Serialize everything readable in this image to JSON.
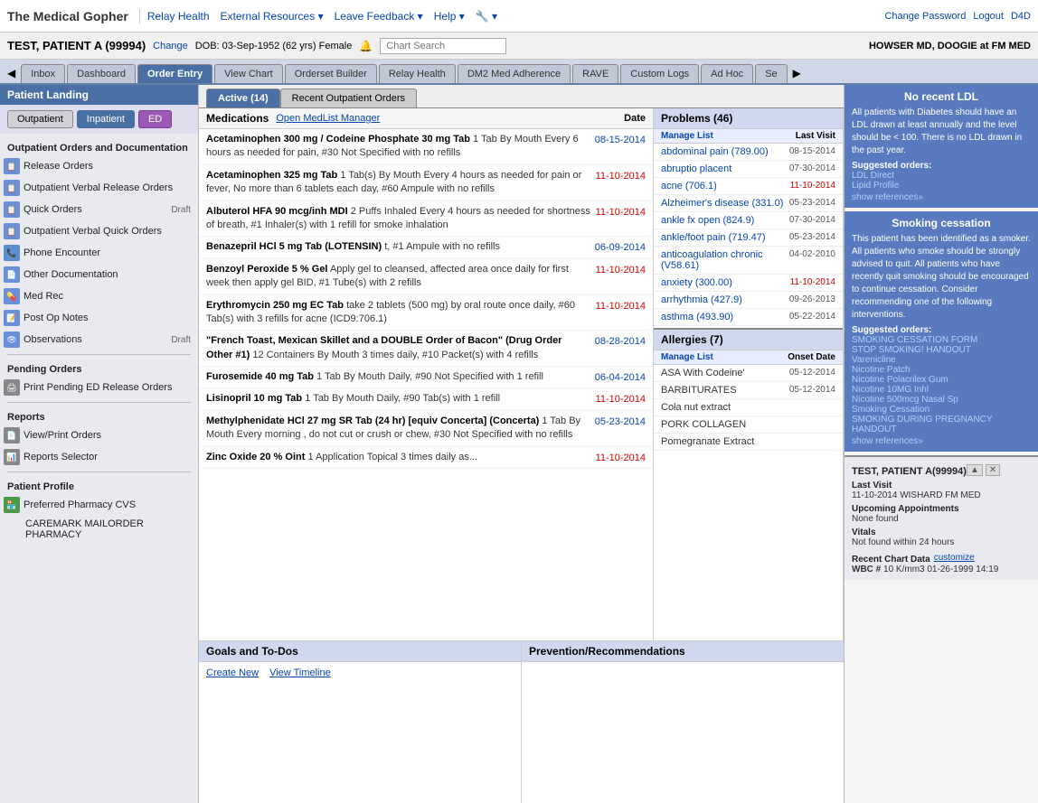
{
  "app": {
    "title": "The Medical Gopher"
  },
  "top_nav": {
    "items": [
      {
        "label": "Relay Health",
        "id": "relay-health"
      },
      {
        "label": "External Resources ▾",
        "id": "external-resources"
      },
      {
        "label": "Leave Feedback ▾",
        "id": "leave-feedback"
      },
      {
        "label": "Help ▾",
        "id": "help"
      },
      {
        "label": "🔧 ▾",
        "id": "tools"
      }
    ]
  },
  "top_right": {
    "change_password": "Change Password",
    "logout": "Logout",
    "d4d": "D4D"
  },
  "patient": {
    "name": "TEST, PATIENT A (99994)",
    "change_label": "Change",
    "dob": "DOB: 03-Sep-1952 (62 yrs) Female",
    "provider": "HOWSER MD, DOOGIE at FM MED"
  },
  "chart_search": {
    "placeholder": "Chart Search"
  },
  "tabs": [
    {
      "label": "Inbox",
      "id": "inbox"
    },
    {
      "label": "Dashboard",
      "id": "dashboard"
    },
    {
      "label": "Order Entry",
      "id": "order-entry",
      "active": true
    },
    {
      "label": "View Chart",
      "id": "view-chart"
    },
    {
      "label": "Orderset Builder",
      "id": "orderset-builder"
    },
    {
      "label": "Relay Health",
      "id": "relay-health-tab"
    },
    {
      "label": "DM2 Med Adherence",
      "id": "dm2"
    },
    {
      "label": "RAVE",
      "id": "rave"
    },
    {
      "label": "Custom Logs",
      "id": "custom-logs"
    },
    {
      "label": "Ad Hoc",
      "id": "ad-hoc"
    },
    {
      "label": "Se",
      "id": "se"
    }
  ],
  "sidebar": {
    "patient_landing": "Patient Landing",
    "tab_outpatient": "Outpatient",
    "tab_inpatient": "Inpatient",
    "tab_ed": "ED",
    "section_orders": "Outpatient Orders and Documentation",
    "items_orders": [
      {
        "label": "Release Orders",
        "icon": "📋",
        "badge": ""
      },
      {
        "label": "Outpatient Verbal Release Orders",
        "icon": "📋",
        "badge": ""
      },
      {
        "label": "Quick Orders",
        "icon": "📋",
        "badge": "Draft"
      },
      {
        "label": "Outpatient Verbal Quick Orders",
        "icon": "📋",
        "badge": ""
      },
      {
        "label": "Phone Encounter",
        "icon": "📞",
        "badge": ""
      },
      {
        "label": "Other Documentation",
        "icon": "📄",
        "badge": ""
      },
      {
        "label": "Med Rec",
        "icon": "💊",
        "badge": ""
      },
      {
        "label": "Post Op Notes",
        "icon": "📝",
        "badge": ""
      },
      {
        "label": "Observations",
        "icon": "👁",
        "badge": "Draft"
      }
    ],
    "section_pending": "Pending Orders",
    "items_pending": [
      {
        "label": "Print Pending ED Release Orders",
        "icon": "🖨",
        "badge": ""
      }
    ],
    "section_reports": "Reports",
    "items_reports": [
      {
        "label": "View/Print Orders",
        "icon": "📄",
        "badge": ""
      },
      {
        "label": "Reports Selector",
        "icon": "📊",
        "badge": ""
      }
    ],
    "section_profile": "Patient Profile",
    "items_profile": [
      {
        "label": "Preferred Pharmacy CVS",
        "icon": "🏪",
        "badge": ""
      },
      {
        "label": "CAREMARK MAILORDER PHARMACY",
        "icon": "",
        "badge": ""
      }
    ]
  },
  "order_tabs": [
    {
      "label": "Active (14)",
      "id": "active",
      "active": true
    },
    {
      "label": "Recent Outpatient Orders",
      "id": "recent"
    }
  ],
  "medications": {
    "title": "Medications",
    "open_medlist": "Open MedList Manager",
    "date_col": "Date",
    "items": [
      {
        "name": "Acetaminophen 300 mg / Codeine Phosphate 30 mg Tab",
        "detail": "1 Tab By Mouth Every 6 hours as needed for pain, #30 Not Specified with no refills",
        "date": "08-15-2014",
        "recent": false
      },
      {
        "name": "Acetaminophen 325 mg Tab",
        "detail": "1 Tab(s) By Mouth Every 4 hours as needed for pain or fever, No more than 6 tablets each day, #60 Ampule with no refills",
        "date": "11-10-2014",
        "recent": true
      },
      {
        "name": "Albuterol HFA 90 mcg/inh MDI",
        "detail": "2 Puffs Inhaled Every 4 hours as needed for shortness of breath, #1 Inhaler(s) with 1 refill for smoke inhalation",
        "date": "11-10-2014",
        "recent": true
      },
      {
        "name": "Benazepril HCl 5 mg Tab (LOTENSIN)",
        "detail": "t, #1 Ampule with no refills",
        "date": "06-09-2014",
        "recent": false
      },
      {
        "name": "Benzoyl Peroxide 5 % Gel",
        "detail": "Apply gel to cleansed, affected area once daily for first week then apply gel BID, #1 Tube(s) with 2 refills",
        "date": "11-10-2014",
        "recent": true
      },
      {
        "name": "Erythromycin 250 mg EC Tab",
        "detail": "take 2 tablets (500 mg) by oral route once daily, #60 Tab(s) with 3 refills for acne (ICD9:706.1)",
        "date": "11-10-2014",
        "recent": true
      },
      {
        "name": "\"French Toast, Mexican Skillet and a DOUBLE Order of Bacon\" (Drug Order Other #1)",
        "detail": "12 Containers By Mouth 3 times daily, #10 Packet(s) with 4 refills",
        "date": "08-28-2014",
        "recent": false
      },
      {
        "name": "Furosemide 40 mg Tab",
        "detail": "1 Tab By Mouth Daily, #90 Not Specified with 1 refill",
        "date": "06-04-2014",
        "recent": false
      },
      {
        "name": "Lisinopril 10 mg Tab",
        "detail": "1 Tab By Mouth Daily, #90 Tab(s) with 1 refill",
        "date": "11-10-2014",
        "recent": true
      },
      {
        "name": "Methylphenidate HCl 27 mg SR Tab (24 hr) [equiv Concerta] (Concerta)",
        "detail": "1 Tab By Mouth Every morning , do not cut or crush or chew, #30 Not Specified with no refills",
        "date": "05-23-2014",
        "recent": false
      },
      {
        "name": "Zinc Oxide 20 % Oint",
        "detail": "1 Application Topical 3 times daily as...",
        "date": "11-10-2014",
        "recent": true
      }
    ]
  },
  "problems": {
    "title": "Problems (46)",
    "manage_list": "Manage List",
    "last_visit_col": "Last Visit",
    "items": [
      {
        "name": "abdominal pain (789.00)",
        "date": "08-15-2014",
        "recent": false
      },
      {
        "name": "abruptio placent",
        "date": "07-30-2014",
        "recent": false
      },
      {
        "name": "acne (706.1)",
        "date": "11-10-2014",
        "recent": true
      },
      {
        "name": "Alzheimer's disease (331.0)",
        "date": "05-23-2014",
        "recent": false
      },
      {
        "name": "ankle fx open (824.9)",
        "date": "07-30-2014",
        "recent": false
      },
      {
        "name": "ankle/foot pain (719.47)",
        "date": "05-23-2014",
        "recent": false
      },
      {
        "name": "anticoagulation chronic (V58.61)",
        "date": "04-02-2010",
        "recent": false
      },
      {
        "name": "anxiety (300.00)",
        "date": "11-10-2014",
        "recent": true
      },
      {
        "name": "arrhythmia (427.9)",
        "date": "09-26-2013",
        "recent": false
      },
      {
        "name": "asthma (493.90)",
        "date": "05-22-2014",
        "recent": false
      }
    ]
  },
  "allergies": {
    "title": "Allergies (7)",
    "manage_list": "Manage List",
    "onset_col": "Onset Date",
    "items": [
      {
        "name": "ASA With Codeine'",
        "date": "05-12-2014"
      },
      {
        "name": "BARBITURATES",
        "date": "05-12-2014"
      },
      {
        "name": "Cola nut extract",
        "date": ""
      },
      {
        "name": "PORK COLLAGEN",
        "date": ""
      },
      {
        "name": "Pomegranate Extract",
        "date": ""
      }
    ]
  },
  "goals": {
    "title": "Goals and To-Dos",
    "create_new": "Create New",
    "view_timeline": "View Timeline"
  },
  "prevention": {
    "title": "Prevention/Recommendations"
  },
  "ldl_panel": {
    "title": "No recent LDL",
    "content": "All patients with Diabetes should have an LDL drawn at least annually and the level should be < 100. There is no LDL drawn in the past year.",
    "suggested_label": "Suggested orders:",
    "orders": [
      "LDL Direct",
      "Lipid Profile"
    ],
    "show_refs": "show references»"
  },
  "smoking_panel": {
    "title": "Smoking cessation",
    "content": "This patient has been identified as a smoker. All patients who smoke should be strongly advised to quit. All patients who have recently quit smoking should be encouraged to continue cessation. Consider recommending one of the following interventions.",
    "suggested_label": "Suggested orders:",
    "orders": [
      "SMOKING CESSATION FORM",
      "STOP SMOKING! HANDOUT",
      "Varenicline",
      "Nicotine Patch",
      "Nicotine Polacrilex Gum",
      "Nicotine 10MG Inhl",
      "Nicotine 500mcg Nasal Sp",
      "Smoking Cessation",
      "SMOKING DURING PREGNANCY HANDOUT"
    ],
    "show_refs": "show references»"
  },
  "patient_summary": {
    "name": "TEST, PATIENT A(99994)",
    "last_visit_label": "Last Visit",
    "last_visit_value": "11-10-2014 WISHARD FM MED",
    "upcoming_label": "Upcoming Appointments",
    "upcoming_value": "None found",
    "vitals_label": "Vitals",
    "vitals_value": "Not found within 24 hours",
    "recent_chart_label": "Recent Chart Data",
    "customize_link": "customize",
    "wbc_label": "WBC #",
    "wbc_value": "10 K/mm3",
    "wbc_date": "01-26-1999 14:19"
  }
}
